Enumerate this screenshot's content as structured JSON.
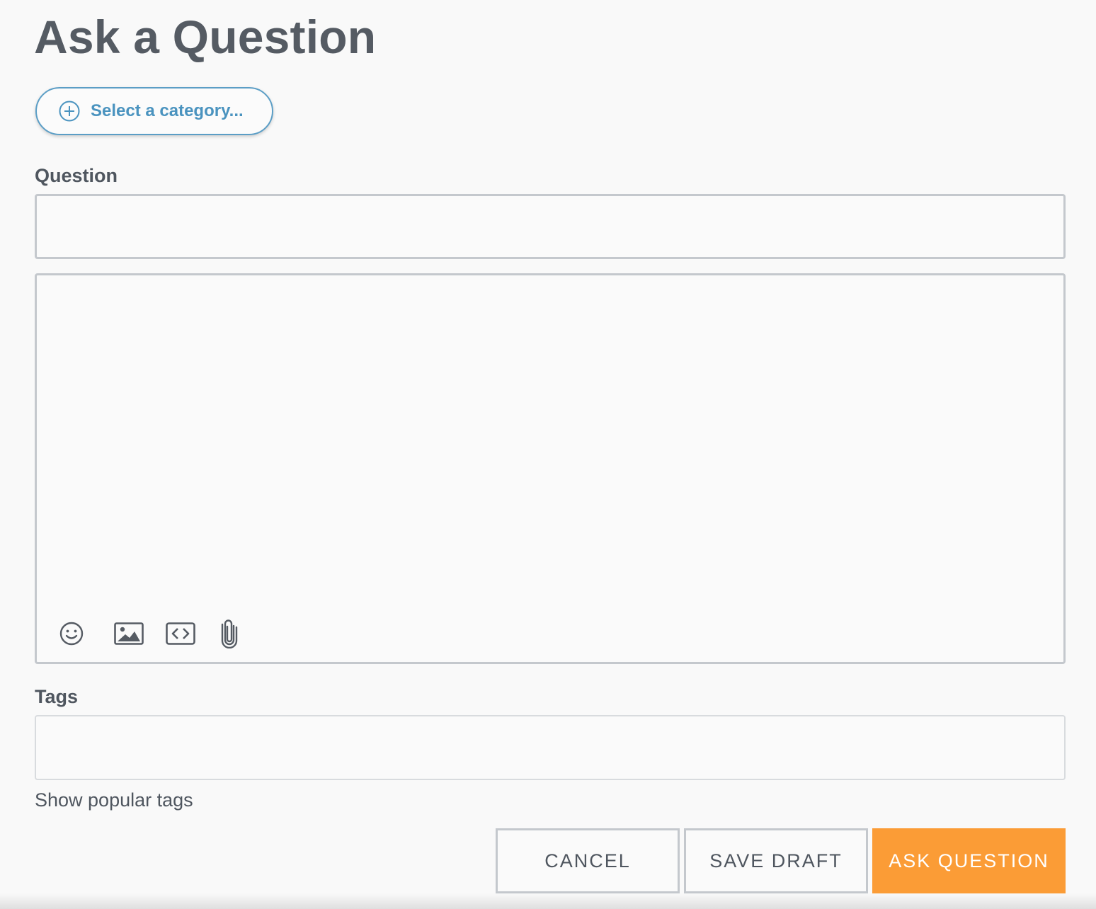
{
  "page": {
    "title": "Ask a Question"
  },
  "category": {
    "label": "Select a category...",
    "icon": "plus-circle-icon",
    "color": "#4a93bf"
  },
  "question": {
    "label": "Question",
    "value": "",
    "placeholder": ""
  },
  "editor": {
    "value": "",
    "toolbar": [
      {
        "name": "emoji",
        "icon": "smiley-icon"
      },
      {
        "name": "image",
        "icon": "image-icon"
      },
      {
        "name": "code",
        "icon": "code-icon"
      },
      {
        "name": "attachment",
        "icon": "paperclip-icon"
      }
    ]
  },
  "tags": {
    "label": "Tags",
    "value": "",
    "placeholder": "",
    "popular_link": "Show popular tags"
  },
  "actions": {
    "cancel": "CANCEL",
    "save_draft": "SAVE DRAFT",
    "ask": "ASK QUESTION",
    "ask_color": "#fb9c36"
  }
}
